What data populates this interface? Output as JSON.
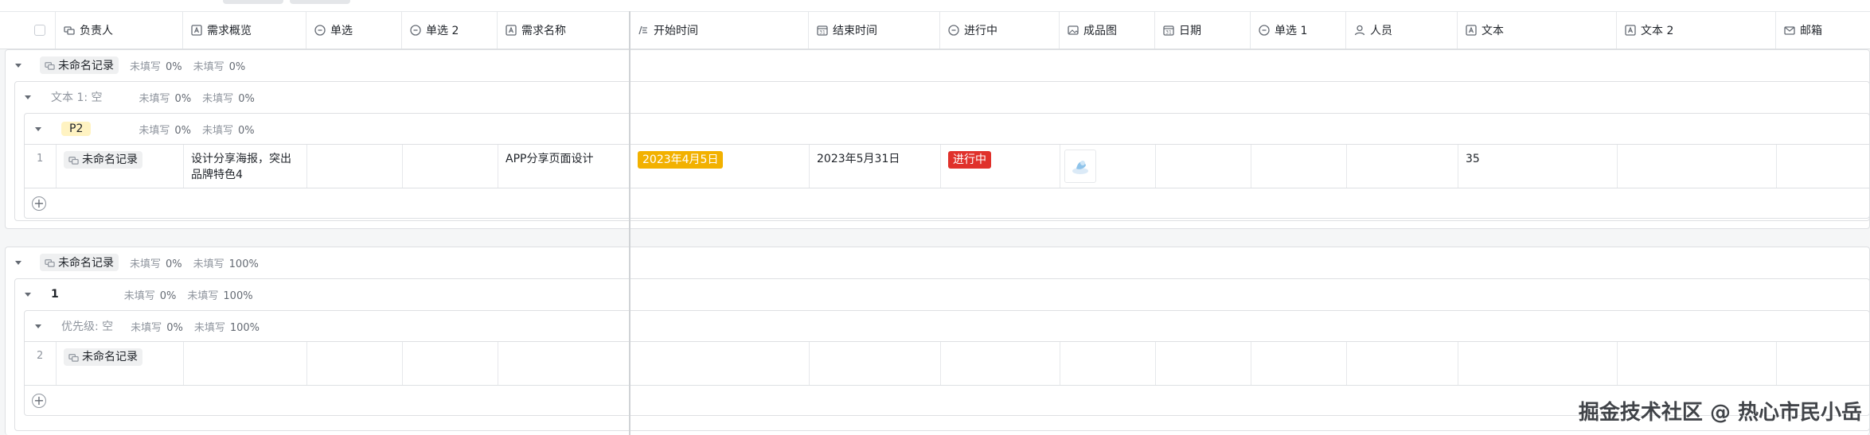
{
  "header": {
    "columns": [
      {
        "label": "负责人",
        "icon": "link-record-icon"
      },
      {
        "label": "需求概览",
        "icon": "text-field-icon"
      },
      {
        "label": "单选",
        "icon": "single-select-icon"
      },
      {
        "label": "单选 2",
        "icon": "single-select-icon"
      },
      {
        "label": "需求名称",
        "icon": "text-field-icon"
      },
      {
        "label": "开始时间",
        "icon": "formula-icon"
      },
      {
        "label": "结束时间",
        "icon": "date-icon"
      },
      {
        "label": "进行中",
        "icon": "single-select-icon"
      },
      {
        "label": "成品图",
        "icon": "image-icon"
      },
      {
        "label": "日期",
        "icon": "date-icon"
      },
      {
        "label": "单选 1",
        "icon": "single-select-icon"
      },
      {
        "label": "人员",
        "icon": "person-icon"
      },
      {
        "label": "文本",
        "icon": "text-field-icon"
      },
      {
        "label": "文本 2",
        "icon": "text-field-icon"
      },
      {
        "label": "邮箱",
        "icon": "mail-icon"
      }
    ]
  },
  "stats": {
    "unfilled_label": "未填写",
    "pct_0": "0%",
    "pct_100": "100%"
  },
  "group1": {
    "record_label": "未命名记录",
    "sub_label": "文本 1: 空",
    "sub_sub_label": "P2",
    "row": {
      "num": "1",
      "owner": "未命名记录",
      "overview": "设计分享海报，突出品牌特色4",
      "name": "APP分享页面设计",
      "start": "2023年4月5日",
      "end": "2023年5月31日",
      "status": "进行中",
      "text": "35"
    }
  },
  "group2": {
    "record_label": "未命名记录",
    "sub_label": "1",
    "sub_sub_label": "优先级: 空",
    "row": {
      "num": "2",
      "owner": "未命名记录"
    }
  },
  "add_symbol": "+",
  "watermark": "掘金技术社区 @ 热心市民小岳",
  "colors": {
    "accent_yellow": "#f2b100",
    "status_red": "#e0312b",
    "p2_bg": "#fff3c2"
  }
}
